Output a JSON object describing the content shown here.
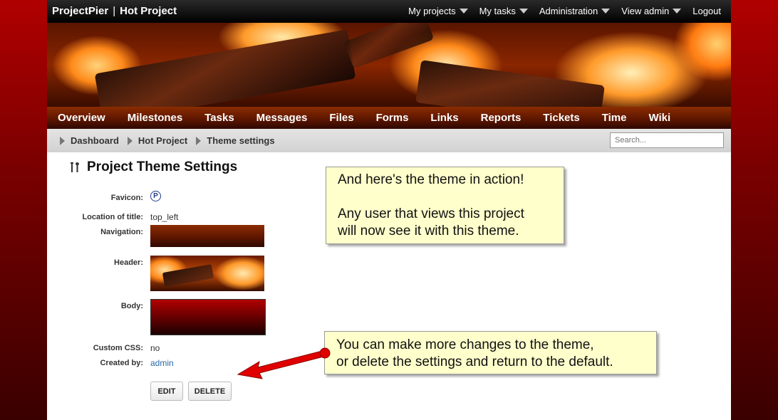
{
  "app": {
    "name": "ProjectPier",
    "project": "Hot Project"
  },
  "top_menu": [
    {
      "label": "My projects",
      "dropdown": true
    },
    {
      "label": "My tasks",
      "dropdown": true
    },
    {
      "label": "Administration",
      "dropdown": true
    },
    {
      "label": "View admin",
      "dropdown": true
    },
    {
      "label": "Logout",
      "dropdown": false
    }
  ],
  "nav_tabs": [
    "Overview",
    "Milestones",
    "Tasks",
    "Messages",
    "Files",
    "Forms",
    "Links",
    "Reports",
    "Tickets",
    "Time",
    "Wiki"
  ],
  "breadcrumb": [
    "Dashboard",
    "Hot Project",
    "Theme settings"
  ],
  "search": {
    "placeholder": "Search..."
  },
  "page": {
    "title": "Project Theme Settings",
    "title_icon": "tools-icon",
    "fields": {
      "favicon_label": "Favicon:",
      "favicon_icon": "p-circle-icon",
      "title_location_label": "Location of title:",
      "title_location_value": "top_left",
      "navigation_label": "Navigation:",
      "header_label": "Header:",
      "body_label": "Body:",
      "custom_css_label": "Custom CSS:",
      "custom_css_value": "no",
      "created_by_label": "Created by:",
      "created_by_value": "admin"
    },
    "buttons": {
      "edit": "EDIT",
      "delete": "DELETE"
    }
  },
  "callouts": {
    "top": [
      "And here's the theme in action!",
      "",
      "Any user that views this project",
      "will now see it with this theme."
    ],
    "bottom": [
      "You can make more changes to the theme,",
      "or delete the settings and return to the default."
    ]
  },
  "colors": {
    "accent_red": "#e00000",
    "callout_bg": "#ffffcc",
    "link": "#2a6aa8",
    "nav_brown": "#5a1500"
  }
}
